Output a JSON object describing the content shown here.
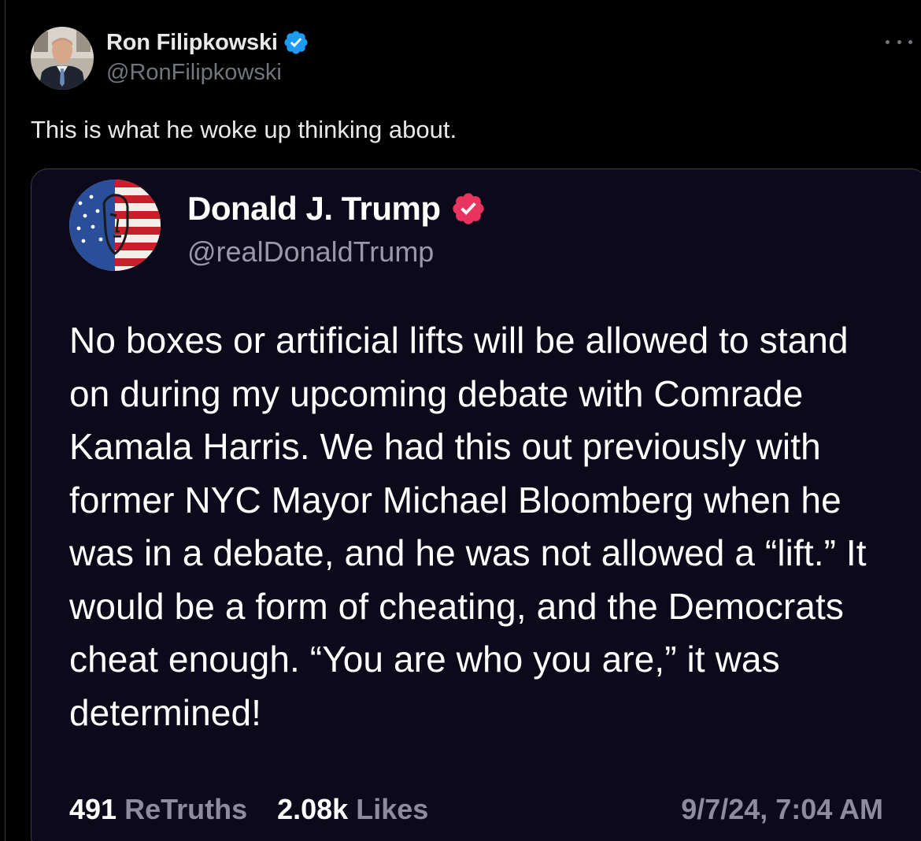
{
  "post": {
    "author_name": "Ron Filipkowski",
    "author_handle": "@RonFilipkowski",
    "text": "This is what he woke up thinking about.",
    "verified_color": "#1d9bf0"
  },
  "quoted": {
    "author_name": "Donald J. Trump",
    "author_handle": "@realDonaldTrump",
    "body": "No boxes or artificial lifts will be allowed to stand on during my upcoming debate with Comrade Kamala Harris. We had this out previously with former NYC Mayor Michael Bloomberg when he was in a debate, and he was not allowed a “lift.” It would be a form of cheating, and the Democrats cheat enough. “You are who you are,” it was determined!",
    "retruths_count": "491",
    "retruths_label": "ReTruths",
    "likes_count": "2.08k",
    "likes_label": "Likes",
    "date": "9/7/24, 7:04 AM",
    "verified_color": "#e8345e"
  },
  "icons": {
    "post_verified": "verified-badge-icon",
    "more": "more-options-icon",
    "quoted_verified": "truth-verified-badge-icon"
  }
}
